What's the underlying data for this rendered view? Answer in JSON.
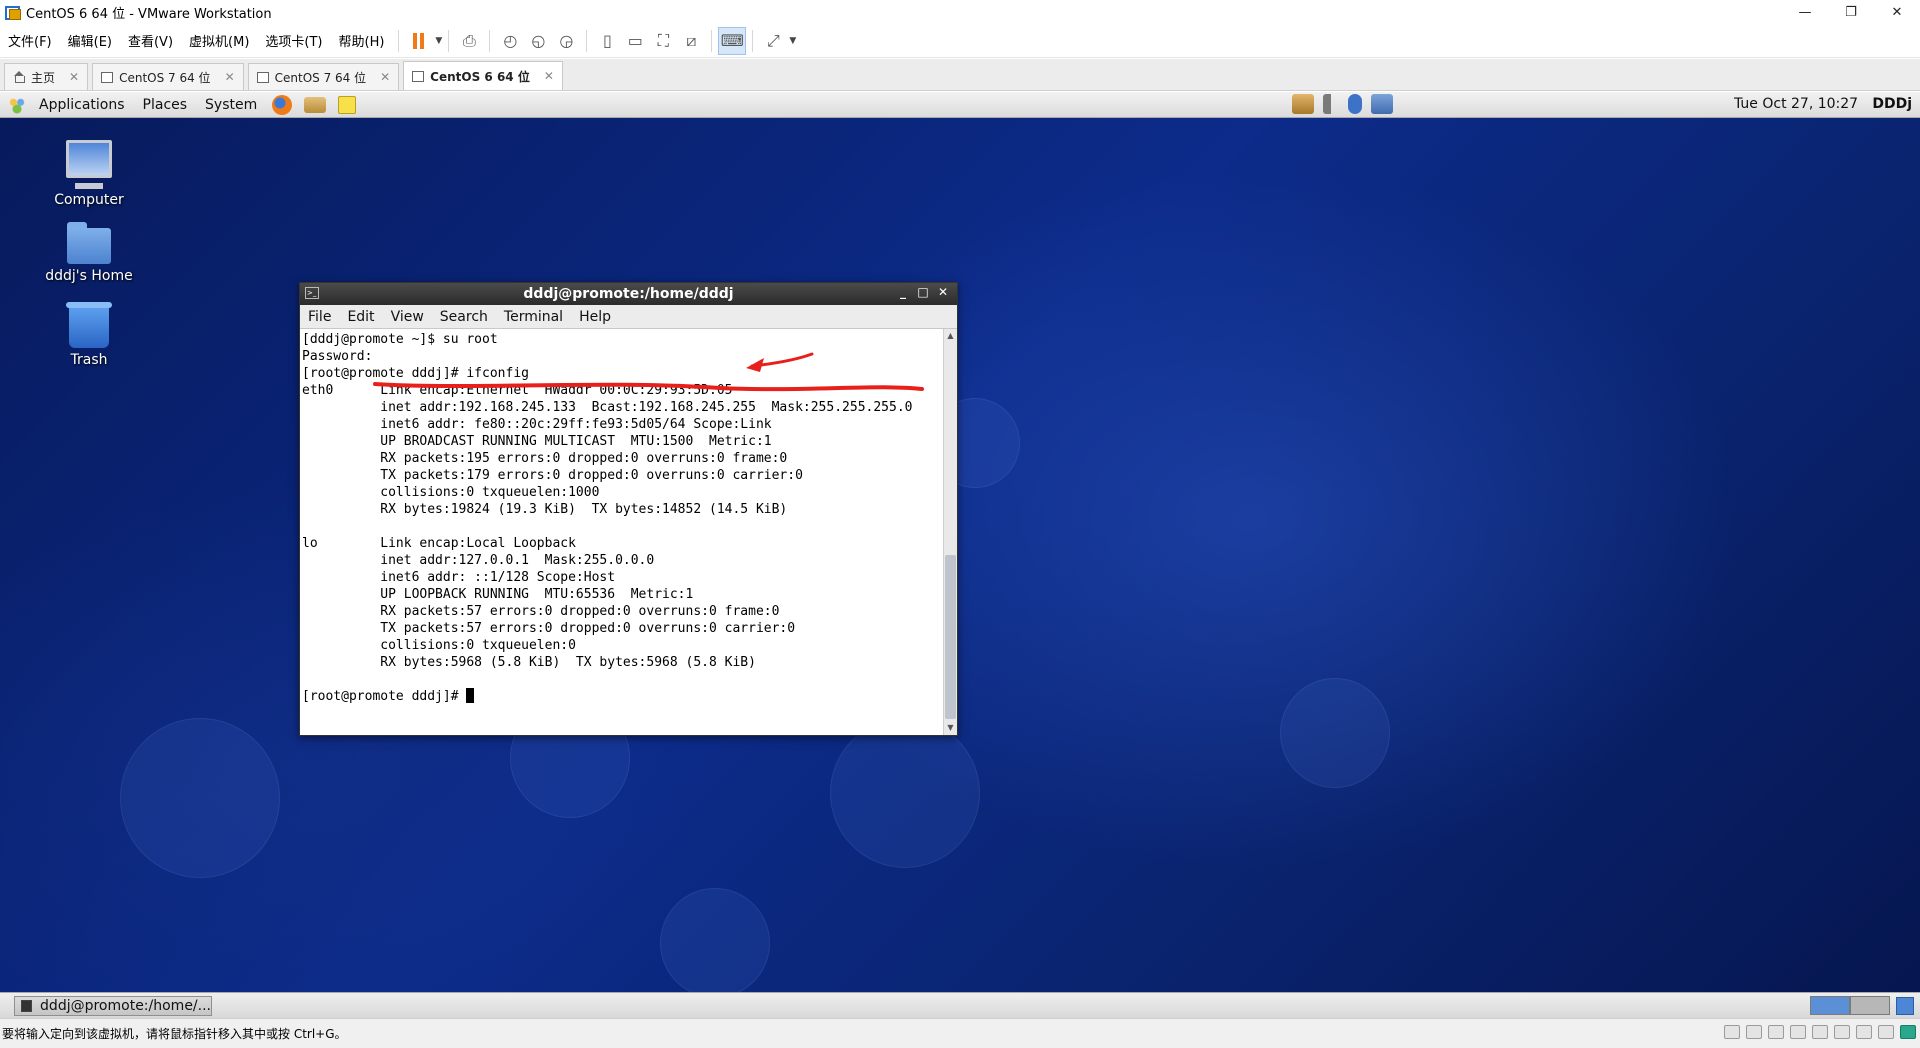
{
  "window": {
    "title": "CentOS 6 64 位 - VMware Workstation",
    "controls": {
      "minimize": "—",
      "restore": "❐",
      "close": "✕"
    }
  },
  "menubar": {
    "items": [
      "文件(F)",
      "编辑(E)",
      "查看(V)",
      "虚拟机(M)",
      "选项卡(T)",
      "帮助(H)"
    ],
    "accent_color": "#f07a16"
  },
  "tabs": [
    {
      "label": "主页",
      "icon": "home-icon",
      "active": false
    },
    {
      "label": "CentOS 7 64 位",
      "icon": "vm-icon",
      "active": false
    },
    {
      "label": "CentOS 7 64 位",
      "icon": "vm-icon",
      "active": false
    },
    {
      "label": "CentOS 6 64 位",
      "icon": "vm-icon",
      "active": true
    }
  ],
  "tab_close": "✕",
  "gnome_panel": {
    "menus": [
      "Applications",
      "Places",
      "System"
    ],
    "clock": "Tue Oct 27, 10:27",
    "user": "DDDj"
  },
  "desktop_icons": [
    {
      "label": "Computer",
      "icon": "computer-icon"
    },
    {
      "label": "dddj's Home",
      "icon": "home-folder-icon"
    },
    {
      "label": "Trash",
      "icon": "trash-icon"
    }
  ],
  "terminal": {
    "title": "dddj@promote:/home/dddj",
    "title_controls": [
      "_",
      "□",
      "✕"
    ],
    "menu": [
      "File",
      "Edit",
      "View",
      "Search",
      "Terminal",
      "Help"
    ],
    "lines": [
      "[dddj@promote ~]$ su root",
      "Password:",
      "[root@promote dddj]# ifconfig",
      "eth0      Link encap:Ethernet  HWaddr 00:0C:29:93:5D:05",
      "          inet addr:192.168.245.133  Bcast:192.168.245.255  Mask:255.255.255.0",
      "          inet6 addr: fe80::20c:29ff:fe93:5d05/64 Scope:Link",
      "          UP BROADCAST RUNNING MULTICAST  MTU:1500  Metric:1",
      "          RX packets:195 errors:0 dropped:0 overruns:0 frame:0",
      "          TX packets:179 errors:0 dropped:0 overruns:0 carrier:0",
      "          collisions:0 txqueuelen:1000",
      "          RX bytes:19824 (19.3 KiB)  TX bytes:14852 (14.5 KiB)",
      "",
      "lo        Link encap:Local Loopback",
      "          inet addr:127.0.0.1  Mask:255.0.0.0",
      "          inet6 addr: ::1/128 Scope:Host",
      "          UP LOOPBACK RUNNING  MTU:65536  Metric:1",
      "          RX packets:57 errors:0 dropped:0 overruns:0 frame:0",
      "          TX packets:57 errors:0 dropped:0 overruns:0 carrier:0",
      "          collisions:0 txqueuelen:0",
      "          RX bytes:5968 (5.8 KiB)  TX bytes:5968 (5.8 KiB)",
      ""
    ],
    "prompt": "[root@promote dddj]# "
  },
  "annotation_color": "#e8201c",
  "taskbar": {
    "task_label": "dddj@promote:/home/..."
  },
  "statusbar": {
    "message": "要将输入定向到该虚拟机，请将鼠标指针移入其中或按 Ctrl+G。"
  }
}
